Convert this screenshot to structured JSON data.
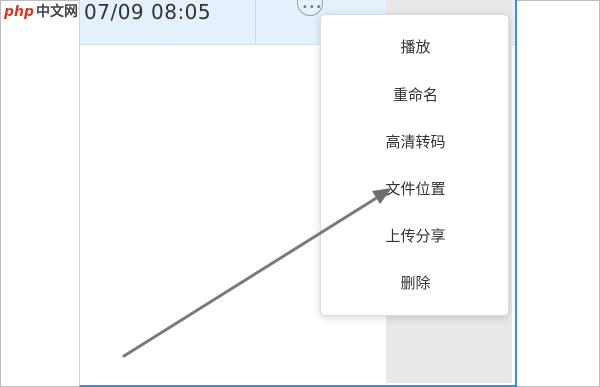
{
  "watermark": {
    "brand": "php",
    "site": "中文网"
  },
  "file_row": {
    "timestamp": "07/09 08:05",
    "more_icon": "ellipsis-circle-icon"
  },
  "context_menu": {
    "items": [
      {
        "label": "播放"
      },
      {
        "label": "重命名"
      },
      {
        "label": "高清转码"
      },
      {
        "label": "文件位置"
      },
      {
        "label": "上传分享"
      },
      {
        "label": "删除"
      }
    ]
  },
  "colors": {
    "row_highlight": "#e4f0fb",
    "window_border": "#3f8fd6",
    "arrow": "#7a7a7a",
    "logo_red": "#d33a2c"
  }
}
